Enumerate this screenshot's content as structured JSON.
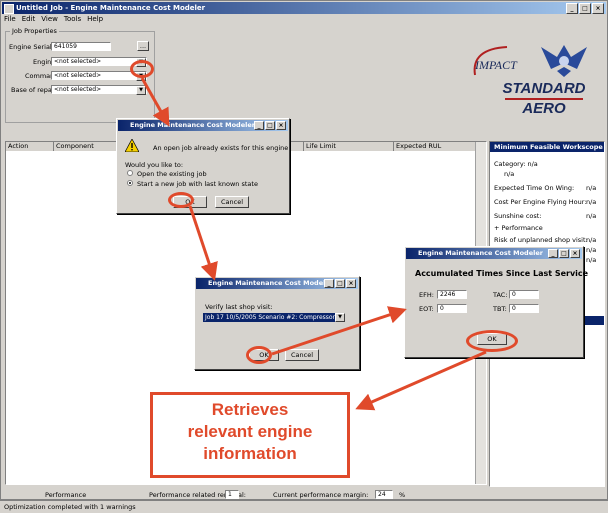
{
  "window": {
    "title": "Untitled Job - Engine Maintenance Cost Modeler"
  },
  "menu": [
    "File",
    "Edit",
    "View",
    "Tools",
    "Help"
  ],
  "job_properties": {
    "group_label": "Job Properties",
    "serial_label": "Engine Serial #:",
    "serial_value": "641059",
    "serial_btn": "...",
    "engine_label": "Engine:",
    "engine_value": "<not selected>",
    "command_label": "Command:",
    "command_value": "<not selected>",
    "base_label": "Base of repair:",
    "base_value": "<not selected>"
  },
  "logos": {
    "impact": "IMPACT",
    "standard": "STANDARD",
    "aero": "AERO"
  },
  "table": {
    "columns": [
      "Action",
      "Component",
      "Life Limit",
      "Expected RUL"
    ]
  },
  "side_panel": {
    "header": "Minimum Feasible Workscope",
    "category_label": "Category: n/a",
    "category_value": "n/a",
    "rows": [
      {
        "label": "Expected Time On Wing:",
        "value": "n/a"
      },
      {
        "label": "Cost Per Engine Flying Hour:",
        "value": "n/a"
      },
      {
        "label": "Sunshine cost:",
        "value": "n/a"
      }
    ],
    "performance": "+ Performance",
    "extra_rows": [
      {
        "label": "Risk of unplanned shop visit:",
        "value": "n/a"
      }
    ],
    "extra_values": [
      "n/a",
      "n/a"
    ]
  },
  "dialog1": {
    "title": "Engine Maintenance Cost Modeler",
    "message": "An open job already exists for this engine",
    "question": "Would you like to:",
    "option1": "Open the existing job",
    "option2": "Start a new job with last known state",
    "ok": "OK",
    "cancel": "Cancel"
  },
  "dialog2": {
    "title": "Engine Maintenance Cost Modeler",
    "label": "Verify last shop visit:",
    "value": "Job 17    10/5/2005    Scenario #2: Compressor F",
    "ok": "OK",
    "cancel": "Cancel"
  },
  "dialog3": {
    "title": "Engine Maintenance Cost Modeler",
    "heading": "Accumulated Times Since Last Service",
    "efh_label": "EFH:",
    "efh_value": "2246",
    "tac_label": "TAC:",
    "tac_value": "0",
    "eot_label": "EOT:",
    "eot_value": "0",
    "tbt_label": "TBT:",
    "tbt_value": "0",
    "ok": "OK"
  },
  "callout": {
    "line1": "Retrieves",
    "line2": "relevant engine",
    "line3": "information"
  },
  "bottom": {
    "performance_label": "Performance",
    "removal_label": "Performance related removal:",
    "removal_value": "1",
    "margin_label": "Current performance margin:",
    "margin_value": "24",
    "margin_unit": "%"
  },
  "status": {
    "text": "Optimization completed with 1 warnings"
  },
  "colors": {
    "accent": "#e04a2b",
    "titlebar": "#0a246a",
    "selection": "#0a246a"
  }
}
